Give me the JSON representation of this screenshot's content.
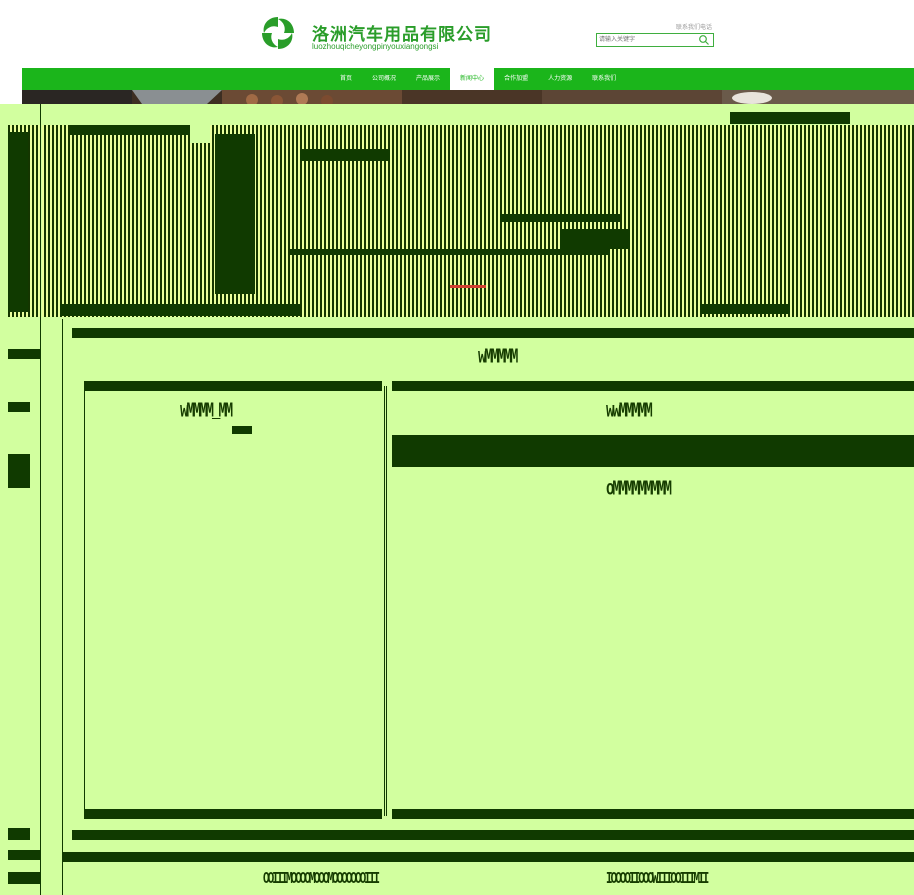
{
  "header": {
    "company_name": "洛洲汽车用品有限公司",
    "company_pinyin": "luozhouqicheyongpinyouxiangongsi",
    "top_link": "联系我们电话",
    "search_placeholder": "请输入关键字"
  },
  "nav": {
    "items": [
      {
        "label": "首页",
        "active": false
      },
      {
        "label": "公司概况",
        "active": false
      },
      {
        "label": "产品展示",
        "active": false
      },
      {
        "label": "新闻中心",
        "active": true
      },
      {
        "label": "合作加盟",
        "active": false
      },
      {
        "label": "人力资源",
        "active": false
      },
      {
        "label": "联系我们",
        "active": false
      }
    ]
  },
  "glitch_text": {
    "center_heading": "wMMMMM",
    "left_title": "wMMMM_MM",
    "right_title": "wwMMMMM",
    "right_subtitle": "oMMMMMMMMM",
    "footer_left": "OOIIIMOOOOMOOOMOOOOOOOIII",
    "footer_right": "IOOOOIIOOOWIIIOOIIIMII"
  },
  "colors": {
    "brand_green": "#1bb51b",
    "logo_green": "#2a9d2a",
    "glitch_bg": "#d2ff9f",
    "glitch_dark": "#103a00"
  }
}
